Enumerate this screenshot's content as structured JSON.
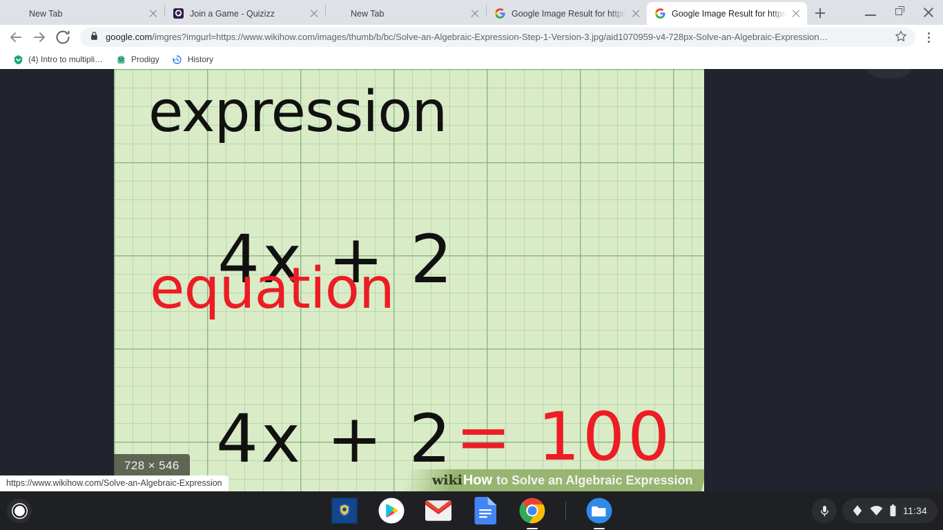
{
  "browser": {
    "tabs": [
      {
        "title": "New Tab",
        "favicon": "none",
        "active": false,
        "closable": true
      },
      {
        "title": "Join a Game - Quizizz",
        "favicon": "quizizz-icon",
        "active": false,
        "closable": true
      },
      {
        "title": "New Tab",
        "favicon": "none",
        "active": false,
        "closable": true
      },
      {
        "title": "Google Image Result for https://",
        "favicon": "google-icon",
        "active": false,
        "closable": true
      },
      {
        "title": "Google Image Result for https://",
        "favicon": "google-icon",
        "active": true,
        "closable": true
      }
    ],
    "new_tab_tooltip": "New tab",
    "window_controls": {
      "minimize": "minimize-icon",
      "maximize": "restore-icon",
      "close": "close-icon"
    },
    "toolbar": {
      "back": "back-arrow-icon",
      "forward": "forward-arrow-icon",
      "reload": "reload-icon",
      "lock": "lock-icon",
      "url_domain": "google.com",
      "url_path": "/imgres?imgurl=https://www.wikihow.com/images/thumb/b/bc/Solve-an-Algebraic-Expression-Step-1-Version-3.jpg/aid1070959-v4-728px-Solve-an-Algebraic-Expression…",
      "bookmark_star": "star-icon",
      "menu": "three-dot-menu-icon"
    },
    "bookmarks": [
      {
        "label": "(4) Intro to multipli…",
        "icon": "green-shield-icon"
      },
      {
        "label": "Prodigy",
        "icon": "prodigy-icon"
      },
      {
        "label": "History",
        "icon": "history-clock-icon"
      }
    ],
    "status_bubble": "https://www.wikihow.com/Solve-an-Algebraic-Expression"
  },
  "image_viewer": {
    "dimensions_badge": "728 × 546",
    "handwriting": {
      "word_expression": "expression",
      "expression_line": "4x + 2",
      "word_equation": "equation",
      "equation_left": "4x + 2",
      "equation_right": "= 100"
    },
    "watermark": {
      "wiki": "wiki",
      "how": "How",
      "rest": "to Solve an Algebraic Expression"
    },
    "colors": {
      "paper": "#d9ecc7",
      "grid": "#5f965f",
      "ink_black": "#111111",
      "ink_red": "#ec1c24",
      "backdrop": "#21242f"
    }
  },
  "shelf": {
    "launcher": "launcher-button",
    "apps": [
      {
        "name": "shield-app-icon",
        "running": false
      },
      {
        "name": "play-store-icon",
        "running": false
      },
      {
        "name": "gmail-icon",
        "running": false
      },
      {
        "name": "google-docs-icon",
        "running": false
      },
      {
        "name": "chrome-icon",
        "running": true
      },
      {
        "name": "files-icon",
        "running": true
      }
    ],
    "tray": {
      "microphone": "microphone-icon",
      "stylus": "stylus-pen-icon",
      "network": "wifi-icon",
      "battery": "battery-icon",
      "clock": "11:34"
    }
  }
}
